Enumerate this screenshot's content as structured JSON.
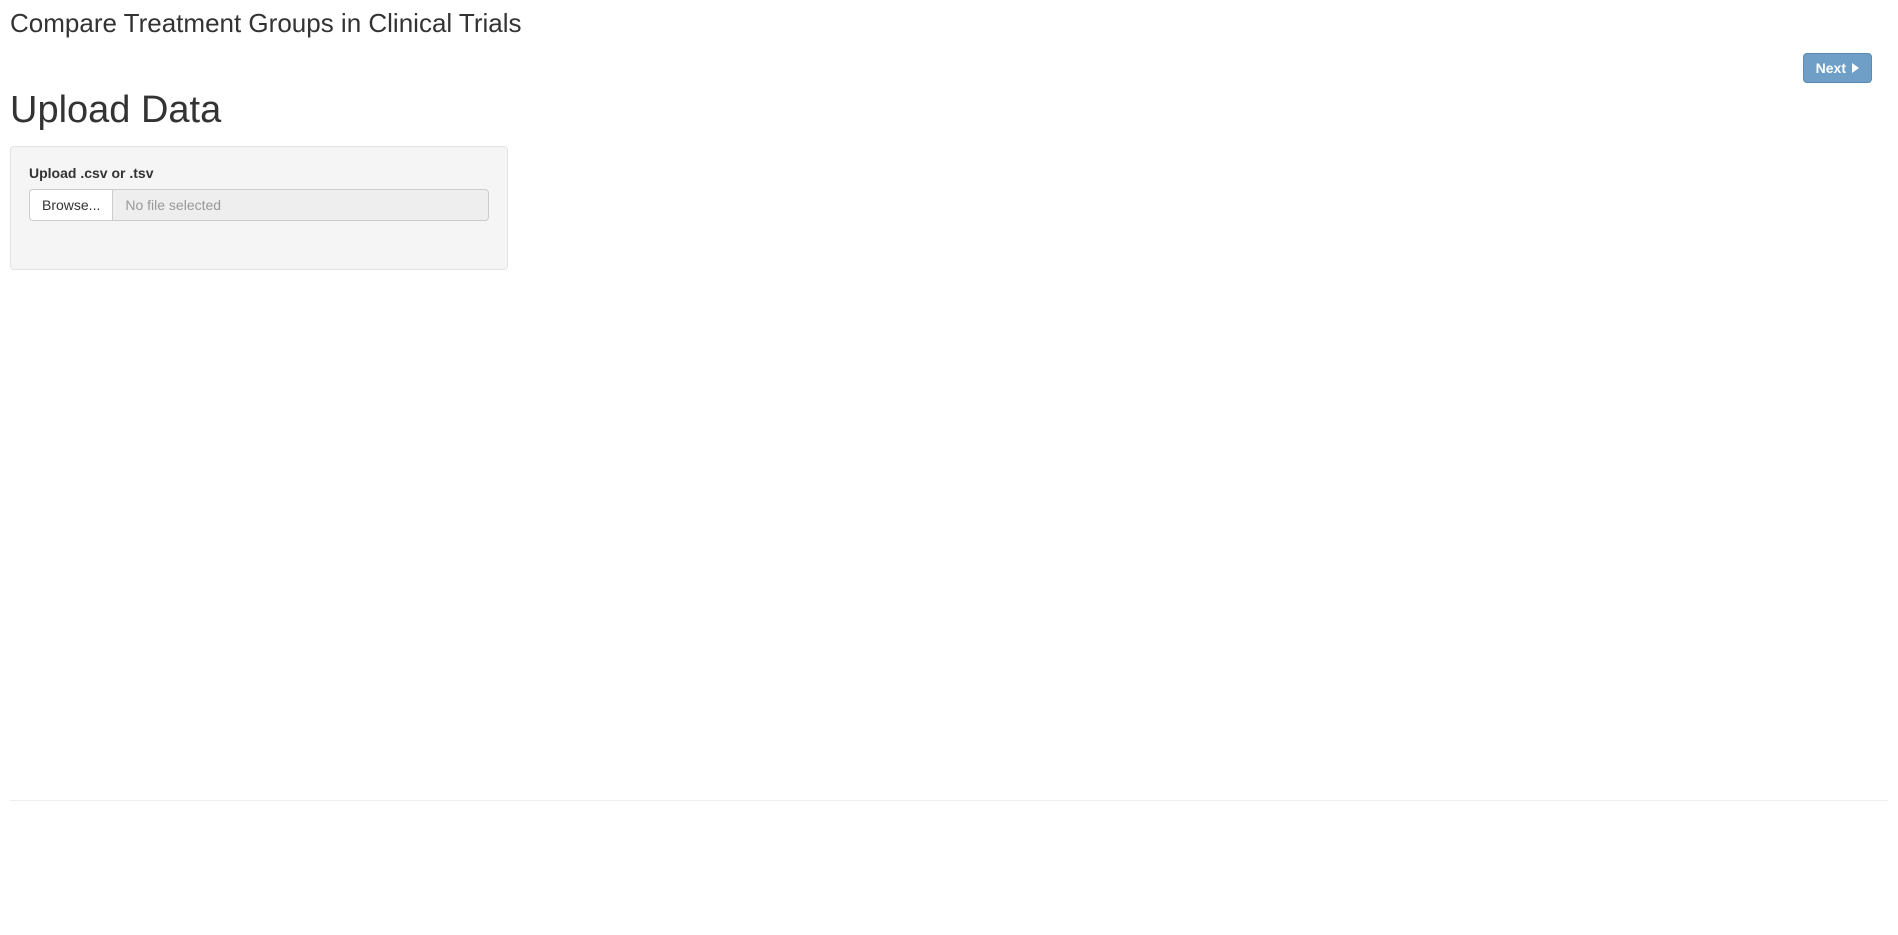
{
  "app": {
    "title": "Compare Treatment Groups in Clinical Trials"
  },
  "actions": {
    "next_label": "Next"
  },
  "main": {
    "heading": "Upload Data",
    "upload": {
      "label": "Upload .csv or .tsv",
      "browse_label": "Browse...",
      "status_text": "No file selected"
    }
  }
}
